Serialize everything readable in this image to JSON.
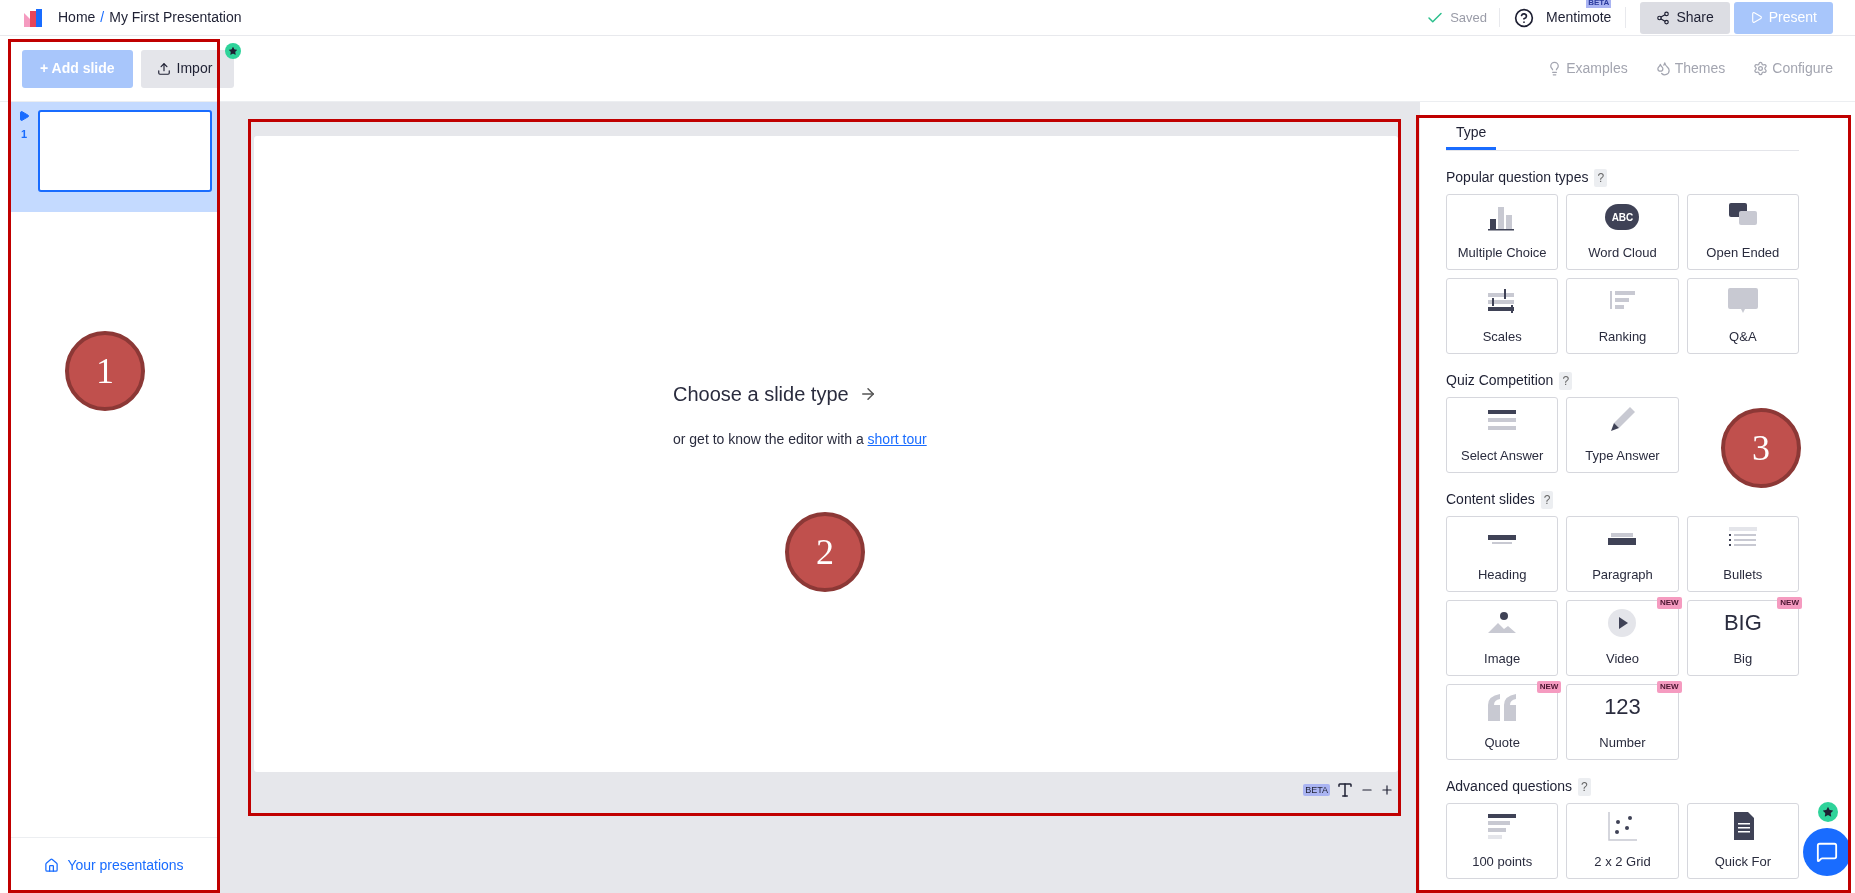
{
  "breadcrumb": {
    "home": "Home",
    "separator": "/",
    "title": "My First Presentation"
  },
  "header": {
    "saved": "Saved",
    "mentimote": "Mentimote",
    "mentimote_badge": "BETA",
    "share": "Share",
    "present": "Present",
    "present_disabled": true
  },
  "toolbar": {
    "add_slide": "+ Add slide",
    "add_slide_disabled": true,
    "import": "Impor",
    "links": [
      "Examples",
      "Themes",
      "Configure"
    ]
  },
  "slides": [
    {
      "number": "1",
      "selected": true
    }
  ],
  "canvas": {
    "title": "Choose a slide type",
    "hint": "or get to know the editor with a",
    "link": "short tour",
    "footer_badge": "BETA"
  },
  "panel": {
    "tabs": [
      {
        "label": "Type",
        "selected": true
      }
    ],
    "sections": [
      {
        "title": "Popular question types",
        "help": "?",
        "tiles": [
          {
            "label": "Multiple Choice",
            "kind": "bars"
          },
          {
            "label": "Word Cloud",
            "kind": "cloud",
            "glyph": "ABC"
          },
          {
            "label": "Open Ended",
            "kind": "bubbles"
          },
          {
            "label": "Scales",
            "kind": "scales"
          },
          {
            "label": "Ranking",
            "kind": "ranking"
          },
          {
            "label": "Q&A",
            "kind": "bubble"
          }
        ]
      },
      {
        "title": "Quiz Competition",
        "help": "?",
        "tiles": [
          {
            "label": "Select Answer",
            "kind": "lines"
          },
          {
            "label": "Type Answer",
            "kind": "pencil"
          }
        ]
      },
      {
        "title": "Content slides",
        "help": "?",
        "tiles": [
          {
            "label": "Heading",
            "kind": "heading"
          },
          {
            "label": "Paragraph",
            "kind": "paragraph"
          },
          {
            "label": "Bullets",
            "kind": "bullets"
          },
          {
            "label": "Image",
            "kind": "image"
          },
          {
            "label": "Video",
            "kind": "video",
            "badge": "NEW"
          },
          {
            "label": "Big",
            "kind": "text",
            "glyph": "BIG",
            "badge": "NEW"
          },
          {
            "label": "Quote",
            "kind": "quote",
            "badge": "NEW"
          },
          {
            "label": "Number",
            "kind": "text",
            "glyph": "123",
            "badge": "NEW"
          }
        ]
      },
      {
        "title": "Advanced questions",
        "help": "?",
        "tiles": [
          {
            "label": "100 points",
            "kind": "points"
          },
          {
            "label": "2 x 2 Grid",
            "kind": "grid"
          },
          {
            "label": "Quick For",
            "kind": "document"
          }
        ]
      }
    ]
  },
  "footer": {
    "your_presentations": "Your presentations"
  },
  "annotations": [
    {
      "label": "1"
    },
    {
      "label": "2"
    },
    {
      "label": "3"
    }
  ]
}
